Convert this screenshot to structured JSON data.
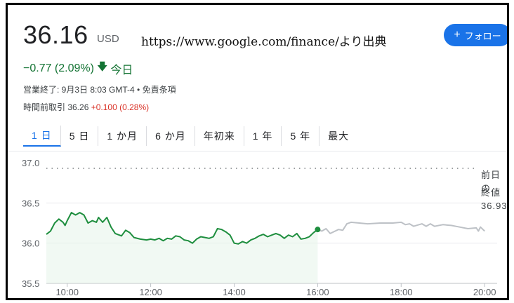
{
  "quote": {
    "price": "36.16",
    "currency": "USD",
    "source_note": "https://www.google.com/finance/より出典",
    "follow_label": "フォロー",
    "change": "−0.77 (2.09%)",
    "change_period": "今日",
    "status_line": "営業終了: 9月3日 8:03 GMT-4 • 免責条項",
    "premarket_label": "時間前取引 36.26",
    "premarket_change": "+0.100 (0.28%)"
  },
  "tabs": [
    "1 日",
    "5 日",
    "1 か月",
    "6 か月",
    "年初来",
    "1 年",
    "5 年",
    "最大"
  ],
  "active_tab": 0,
  "prev_close": {
    "line1": "前日の",
    "line2": "終値",
    "value": "36.93"
  },
  "colors": {
    "positive": "#137333",
    "negative": "#d93025",
    "accent": "#1a73e8",
    "line_main": "#1e8e3e",
    "line_after": "#bdc1c6"
  },
  "chart_data": {
    "type": "line",
    "x_tick_labels": [
      "10:00",
      "12:00",
      "14:00",
      "16:00",
      "18:00",
      "20:00"
    ],
    "x_ticks": [
      10,
      12,
      14,
      16,
      18,
      20
    ],
    "y_tick_labels": [
      "37.0",
      "36.5",
      "36.0",
      "35.5"
    ],
    "y_ticks": [
      37.0,
      36.5,
      36.0,
      35.5
    ],
    "ylim": [
      35.5,
      37.0
    ],
    "xlim": [
      9.5,
      20.3
    ],
    "prev_close": 36.93,
    "series": [
      {
        "values": [
          [
            9.5,
            36.11
          ],
          [
            9.6,
            36.15
          ],
          [
            9.7,
            36.25
          ],
          [
            9.8,
            36.3
          ],
          [
            9.9,
            36.26
          ],
          [
            9.95,
            36.22
          ],
          [
            10.0,
            36.28
          ],
          [
            10.1,
            36.38
          ],
          [
            10.2,
            36.35
          ],
          [
            10.3,
            36.38
          ],
          [
            10.4,
            36.35
          ],
          [
            10.5,
            36.25
          ],
          [
            10.6,
            36.28
          ],
          [
            10.7,
            36.26
          ],
          [
            10.75,
            36.32
          ],
          [
            10.85,
            36.26
          ],
          [
            10.95,
            36.32
          ],
          [
            11.05,
            36.2
          ],
          [
            11.15,
            36.12
          ],
          [
            11.3,
            36.09
          ],
          [
            11.4,
            36.16
          ],
          [
            11.5,
            36.13
          ],
          [
            11.6,
            36.07
          ],
          [
            11.75,
            36.05
          ],
          [
            11.9,
            36.04
          ],
          [
            12.0,
            36.05
          ],
          [
            12.1,
            36.04
          ],
          [
            12.2,
            36.06
          ],
          [
            12.3,
            36.03
          ],
          [
            12.4,
            36.06
          ],
          [
            12.5,
            36.05
          ],
          [
            12.6,
            36.09
          ],
          [
            12.7,
            36.08
          ],
          [
            12.8,
            36.04
          ],
          [
            12.9,
            36.03
          ],
          [
            13.0,
            36.0
          ],
          [
            13.1,
            36.05
          ],
          [
            13.2,
            36.08
          ],
          [
            13.3,
            36.07
          ],
          [
            13.4,
            36.06
          ],
          [
            13.5,
            36.08
          ],
          [
            13.6,
            36.18
          ],
          [
            13.7,
            36.17
          ],
          [
            13.8,
            36.14
          ],
          [
            13.9,
            36.1
          ],
          [
            14.0,
            36.0
          ],
          [
            14.1,
            35.99
          ],
          [
            14.2,
            36.02
          ],
          [
            14.3,
            36.0
          ],
          [
            14.4,
            36.04
          ],
          [
            14.5,
            36.06
          ],
          [
            14.6,
            36.09
          ],
          [
            14.7,
            36.11
          ],
          [
            14.8,
            36.08
          ],
          [
            14.9,
            36.1
          ],
          [
            15.0,
            36.12
          ],
          [
            15.1,
            36.1
          ],
          [
            15.2,
            36.06
          ],
          [
            15.3,
            36.1
          ],
          [
            15.4,
            36.08
          ],
          [
            15.5,
            36.12
          ],
          [
            15.6,
            36.05
          ],
          [
            15.7,
            36.06
          ],
          [
            15.8,
            36.08
          ],
          [
            15.9,
            36.13
          ],
          [
            16.0,
            36.17
          ]
        ]
      },
      {
        "values": [
          [
            16.0,
            36.17
          ],
          [
            16.1,
            36.15
          ],
          [
            16.2,
            36.18
          ],
          [
            16.3,
            36.12
          ],
          [
            16.5,
            36.17
          ],
          [
            16.6,
            36.16
          ],
          [
            16.7,
            36.24
          ],
          [
            16.8,
            36.26
          ],
          [
            17.0,
            36.25
          ],
          [
            17.2,
            36.24
          ],
          [
            17.5,
            36.25
          ],
          [
            17.8,
            36.25
          ],
          [
            18.0,
            36.26
          ],
          [
            18.1,
            36.23
          ],
          [
            18.2,
            36.24
          ],
          [
            18.3,
            36.21
          ],
          [
            18.5,
            36.24
          ],
          [
            18.6,
            36.21
          ],
          [
            18.7,
            36.24
          ],
          [
            18.8,
            36.21
          ],
          [
            19.0,
            36.23
          ],
          [
            19.2,
            36.22
          ],
          [
            19.4,
            36.2
          ],
          [
            19.6,
            36.18
          ],
          [
            19.8,
            36.19
          ],
          [
            19.85,
            36.15
          ],
          [
            19.9,
            36.2
          ],
          [
            20.0,
            36.15
          ]
        ]
      }
    ]
  }
}
